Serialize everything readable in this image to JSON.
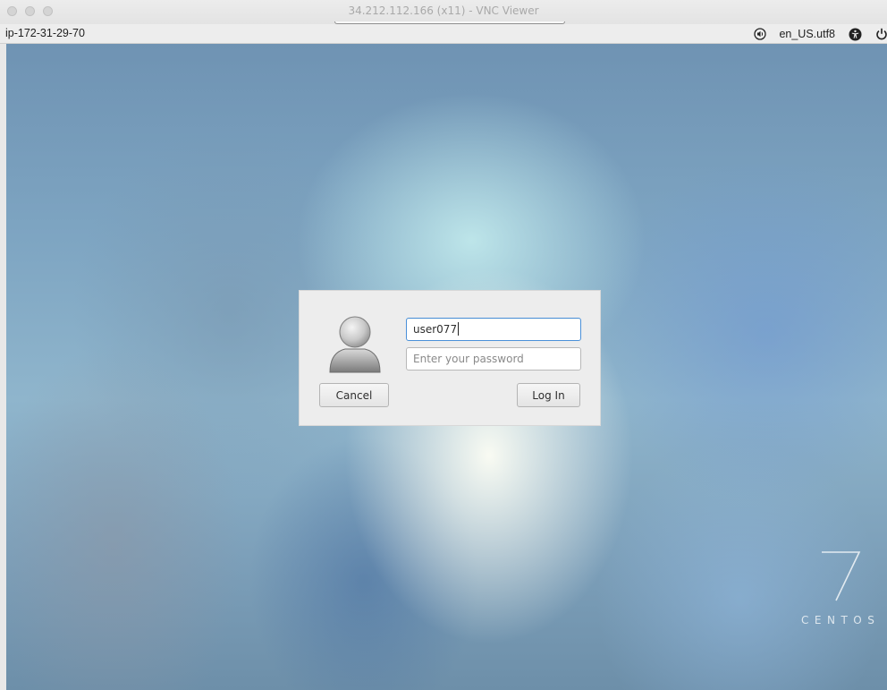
{
  "window": {
    "title": "34.212.112.166 (x11) - VNC Viewer"
  },
  "topbar": {
    "hostname": "ip-172-31-29-70",
    "locale": "en_US.utf8",
    "icons": [
      "volume-icon",
      "accessibility-icon",
      "power-icon"
    ]
  },
  "login": {
    "username_value": "user077",
    "password_placeholder": "Enter your password",
    "cancel_label": "Cancel",
    "login_label": "Log In",
    "avatar_icon": "user-avatar-icon"
  },
  "branding": {
    "version": "7",
    "name": "CENTOS"
  },
  "colors": {
    "focus_border": "#4a90d9",
    "dialog_bg": "#ededed",
    "topbar_bg": "#ededed"
  }
}
